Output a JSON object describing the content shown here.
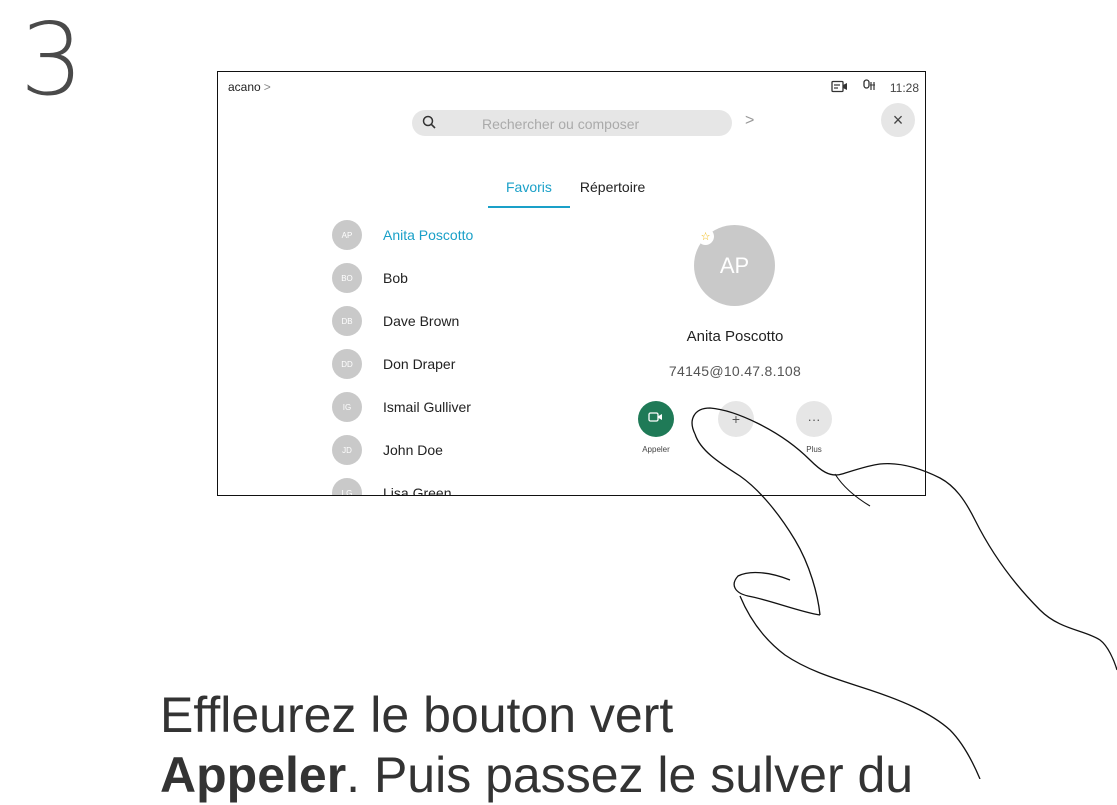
{
  "step": "3",
  "status_bar": {
    "breadcrumb": "acano",
    "breadcrumb_chevron": ">",
    "camera_icon": "camera-icon",
    "mic_icon": "microphone-muted-icon",
    "time": "11:28"
  },
  "search": {
    "placeholder": "Rechercher ou composer",
    "go_chevron": ">"
  },
  "close_label": "×",
  "tabs": [
    {
      "label": "Favoris",
      "active": true
    },
    {
      "label": "Répertoire",
      "active": false
    }
  ],
  "contacts": [
    {
      "initials": "AP",
      "name": "Anita Poscotto",
      "selected": true
    },
    {
      "initials": "BO",
      "name": "Bob",
      "selected": false
    },
    {
      "initials": "DB",
      "name": "Dave Brown",
      "selected": false
    },
    {
      "initials": "DD",
      "name": "Don Draper",
      "selected": false
    },
    {
      "initials": "IG",
      "name": "Ismail Gulliver",
      "selected": false
    },
    {
      "initials": "JD",
      "name": "John Doe",
      "selected": false
    },
    {
      "initials": "LG",
      "name": "Lisa Green",
      "selected": false
    }
  ],
  "detail": {
    "initials": "AP",
    "name": "Anita Poscotto",
    "address": "74145@10.47.8.108",
    "favorite_star": "☆"
  },
  "actions": {
    "call_label": "Appeler",
    "more_label": "Plus",
    "more_glyph": "···",
    "mid_glyph": "+"
  },
  "instruction": {
    "line1": "Effleurez le bouton vert",
    "line2_bold": "Appeler",
    "line2_rest": ". Puis passez le sulver du"
  },
  "colors": {
    "accent": "#1aa0c8",
    "call_green": "#1f7a57",
    "avatar_gray": "#c9c9c9"
  }
}
